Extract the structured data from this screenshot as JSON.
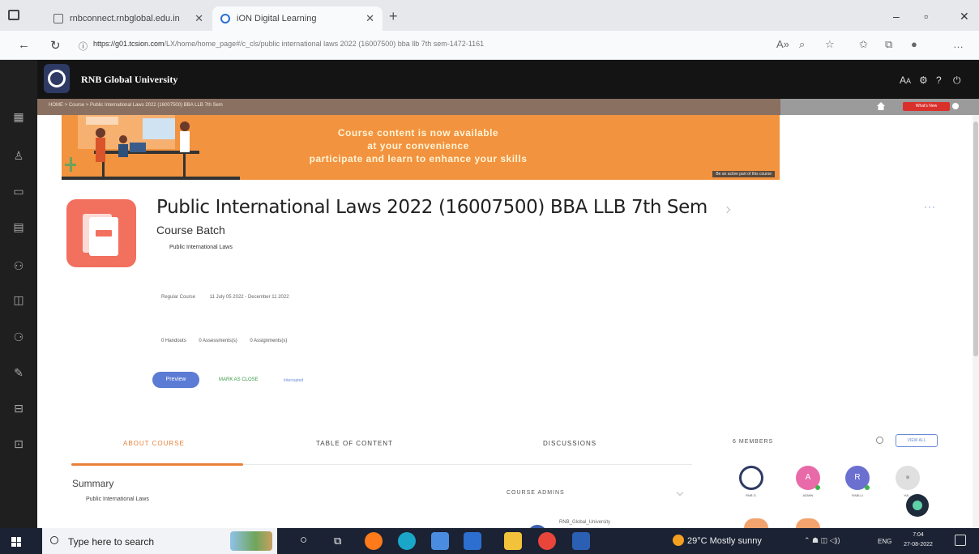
{
  "browser": {
    "tabs": [
      {
        "label": "rnbconnect.rnbglobal.edu.in"
      },
      {
        "label": "iON Digital Learning"
      }
    ],
    "url_host": "https://g01.tcsion.com",
    "url_path": "/LX/home/home_page#/c_cls/public international laws 2022 (16007500) bba llb 7th sem-1472-1161"
  },
  "app": {
    "brand": "RNB Global University"
  },
  "breadcrumb": "HOME  >  Course  >  Public International Laws 2022 (16007500) BBA LLB 7th Sem",
  "whats_new": "What's New",
  "banner": {
    "line1": "Course content is now available",
    "line2": "at your convenience",
    "line3": "participate and learn to enhance your skills",
    "tag": "Be an active part of this course"
  },
  "course": {
    "title": "Public International Laws 2022 (16007500) BBA LLB 7th Sem",
    "batch": "Course Batch",
    "subject": "Public International Laws",
    "type": "Regular Course",
    "dates": "11 July 05 2022 - December 11 2022",
    "stats": [
      "0 Handouts",
      "0 Assessments(s)",
      "0 Assignments(s)"
    ],
    "preview_label": "Preview",
    "mark_close_label": "MARK AS CLOSE",
    "interrupt_label": "Interrupted"
  },
  "tabs": [
    {
      "label": "ABOUT COURSE"
    },
    {
      "label": "TABLE OF CONTENT"
    },
    {
      "label": "DISCUSSIONS"
    }
  ],
  "about": {
    "summary_heading": "Summary",
    "summary_text": "Public International Laws",
    "admins_heading": "COURSE ADMINS",
    "admin_name": "RNB_Global_University"
  },
  "members": {
    "heading": "6 MEMBERS",
    "view_all": "VIEW ALL",
    "list": [
      {
        "name": "RNB G.",
        "color": "#2e3a63"
      },
      {
        "name": "ADMIN",
        "color": "#e86aa8"
      },
      {
        "name": "RABLLI",
        "color": "#6a6fd0"
      },
      {
        "name": "HA...",
        "color": "#bdbdbd"
      }
    ]
  },
  "taskbar": {
    "search_placeholder": "Type here to search",
    "weather": "29°C  Mostly sunny",
    "lang": "ENG",
    "time": "7:04",
    "date": "27-08-2022"
  },
  "colors": {
    "banner": "#f2933f",
    "accent": "#e8803a",
    "header": "#141414",
    "sidebar": "#1f1f1f",
    "course_icon": "#f2705e"
  }
}
